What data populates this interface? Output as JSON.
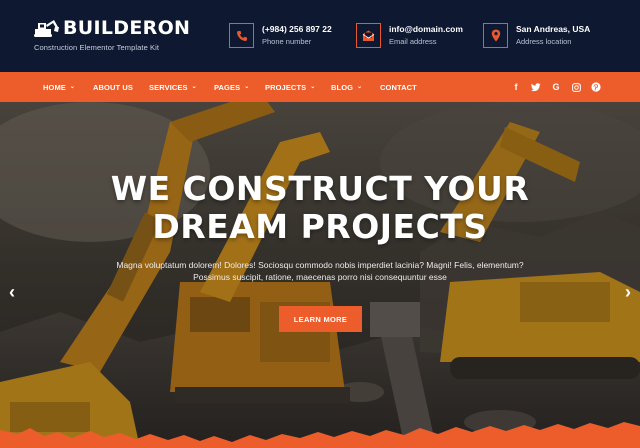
{
  "brand": {
    "name": "BUILDERON",
    "tagline": "Construction Elementor Template Kit",
    "logo_icon": "excavator-icon"
  },
  "contact": [
    {
      "icon": "phone-icon",
      "title": "(+984) 256 897 22",
      "label": "Phone number"
    },
    {
      "icon": "email-icon",
      "title": "info@domain.com",
      "label": "Email address"
    },
    {
      "icon": "location-pin-icon",
      "title": "San Andreas, USA",
      "label": "Address location"
    }
  ],
  "nav": {
    "items": [
      {
        "label": "HOME",
        "has_dropdown": true
      },
      {
        "label": "ABOUT US",
        "has_dropdown": false
      },
      {
        "label": "SERVICES",
        "has_dropdown": true
      },
      {
        "label": "PAGES",
        "has_dropdown": true
      },
      {
        "label": "PROJECTS",
        "has_dropdown": true
      },
      {
        "label": "BLOG",
        "has_dropdown": true
      },
      {
        "label": "CONTACT",
        "has_dropdown": false
      }
    ],
    "social": [
      {
        "name": "facebook-icon",
        "glyph": "f"
      },
      {
        "name": "twitter-icon",
        "glyph": "🐦"
      },
      {
        "name": "google-icon",
        "glyph": "G"
      },
      {
        "name": "instagram-icon",
        "glyph": "◎"
      },
      {
        "name": "pinterest-icon",
        "glyph": "℗"
      }
    ]
  },
  "hero": {
    "title_line1": "WE CONSTRUCT YOUR",
    "title_line2": "DREAM PROJECTS",
    "description": "Magna voluptatum dolorem! Dolores! Sociosqu commodo nobis imperdiet lacinia? Magni! Felis, elementum? Possimus suscipit, ratione, maecenas porro nisi consequuntur esse",
    "button_label": "LEARN MORE",
    "prev_icon": "chevron-left-icon",
    "next_icon": "chevron-right-icon"
  },
  "colors": {
    "accent": "#ec5d2b",
    "header_bg": "#0e1830",
    "machine_yellow": "#d99a1c"
  }
}
